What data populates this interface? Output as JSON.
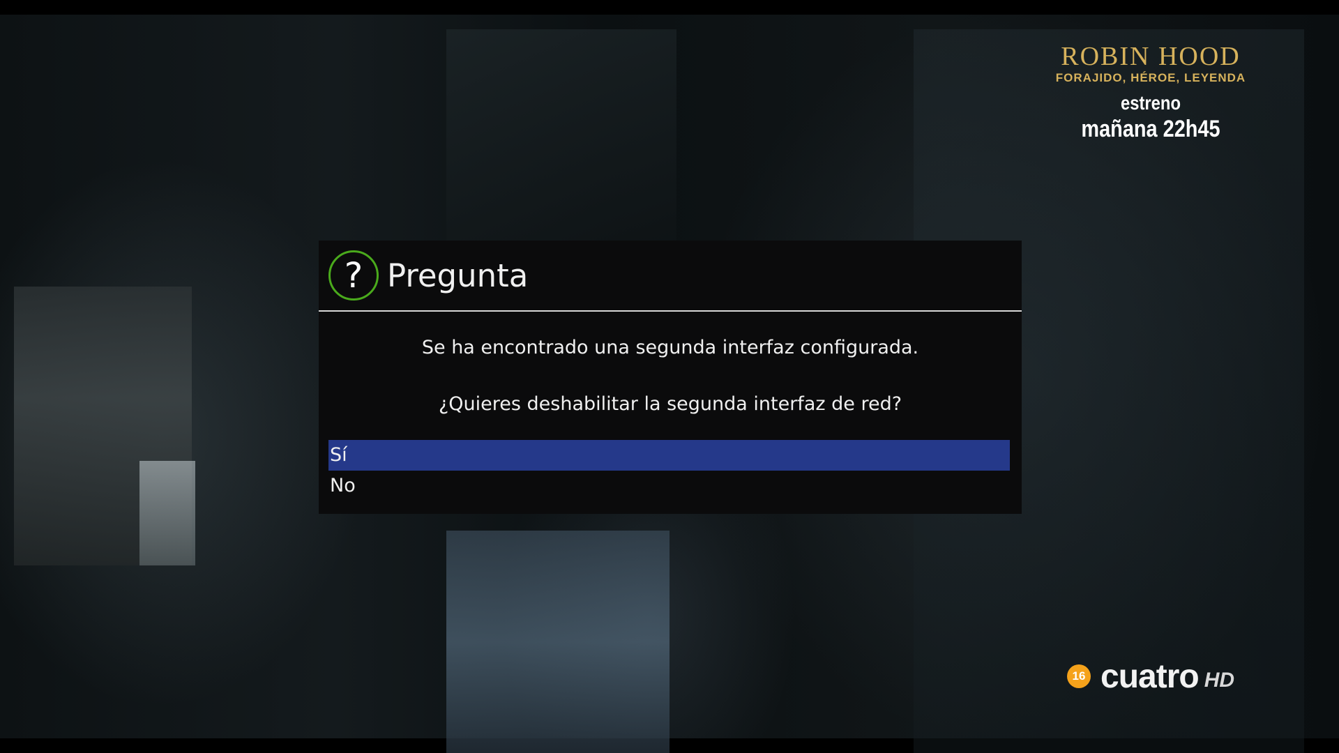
{
  "promo": {
    "title": "ROBIN HOOD",
    "subtitle": "FORAJIDO, HÉROE, LEYENDA",
    "line1": "estreno",
    "line2": "mañana 22h45"
  },
  "channel": {
    "age_rating": "16",
    "name": "cuatro",
    "hd": "HD"
  },
  "dialog": {
    "icon": "question-icon",
    "title": "Pregunta",
    "message_line1": "Se ha encontrado una segunda interfaz configurada.",
    "message_line2": "¿Quieres deshabilitar la segunda interfaz de red?",
    "options": [
      {
        "label": "Sí",
        "selected": true
      },
      {
        "label": "No",
        "selected": false
      }
    ]
  },
  "colors": {
    "selection": "#25398a",
    "icon_ring": "#4aaa1c",
    "promo_gold": "#d7b25c",
    "age_badge": "#f5a21b"
  }
}
